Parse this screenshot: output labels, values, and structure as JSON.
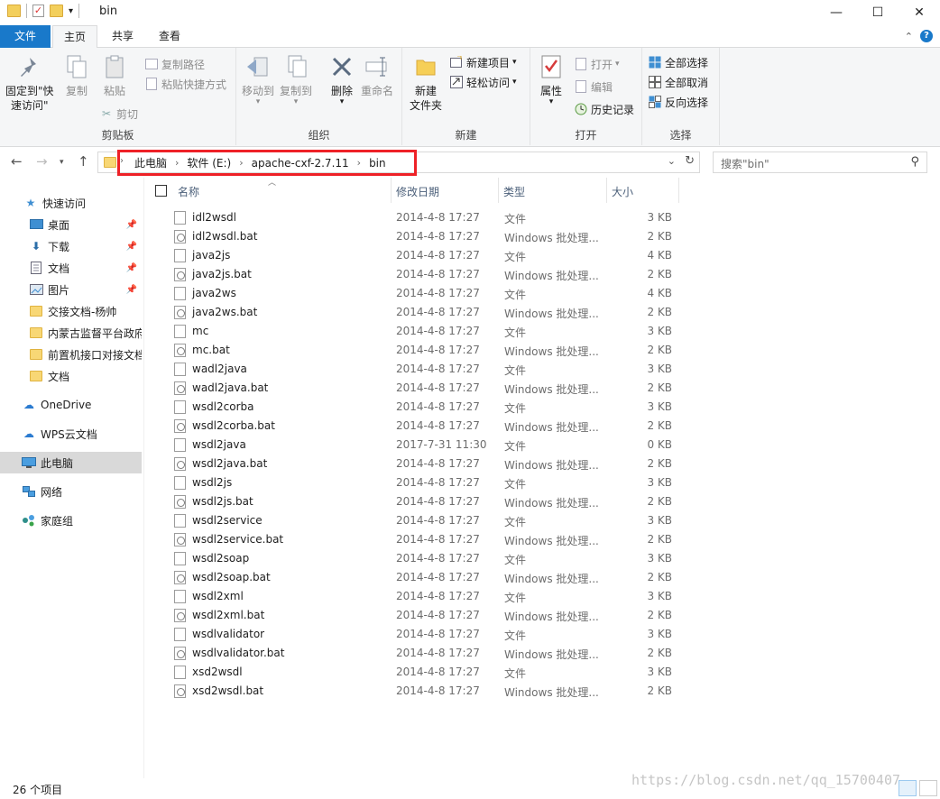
{
  "window": {
    "title": "bin",
    "minimize": "—",
    "maximize": "☐",
    "close": "✕"
  },
  "ribbon_tabs": {
    "file": "文件",
    "home": "主页",
    "share": "共享",
    "view": "查看"
  },
  "ribbon": {
    "clipboard": {
      "pin_label_1": "固定到\"快",
      "pin_label_2": "速访问\"",
      "copy": "复制",
      "paste": "粘贴",
      "copy_path": "复制路径",
      "paste_shortcut": "粘贴快捷方式",
      "cut": "剪切",
      "group": "剪贴板"
    },
    "organize": {
      "move_to": "移动到",
      "copy_to": "复制到",
      "delete": "删除",
      "rename": "重命名",
      "group": "组织"
    },
    "new": {
      "new_folder_1": "新建",
      "new_folder_2": "文件夹",
      "new_item": "新建项目",
      "easy_access": "轻松访问",
      "group": "新建"
    },
    "open": {
      "properties": "属性",
      "open": "打开",
      "edit": "编辑",
      "history": "历史记录",
      "group": "打开"
    },
    "select": {
      "select_all": "全部选择",
      "select_none": "全部取消",
      "invert": "反向选择",
      "group": "选择"
    }
  },
  "address": {
    "crumbs": [
      "此电脑",
      "软件 (E:)",
      "apache-cxf-2.7.11",
      "bin"
    ],
    "search_placeholder": "搜索\"bin\""
  },
  "nav_pane": [
    {
      "label": "快速访问",
      "icon": "star-icon",
      "pinned": false
    },
    {
      "label": "桌面",
      "icon": "desktop-icon",
      "pinned": true
    },
    {
      "label": "下载",
      "icon": "download-icon",
      "pinned": true
    },
    {
      "label": "文档",
      "icon": "documents-icon",
      "pinned": true
    },
    {
      "label": "图片",
      "icon": "pictures-icon",
      "pinned": true
    },
    {
      "label": "交接文档-杨帅",
      "icon": "folder-icon",
      "pinned": false
    },
    {
      "label": "内蒙古监督平台政府",
      "icon": "folder-icon",
      "pinned": false
    },
    {
      "label": "前置机接口对接文档",
      "icon": "folder-icon",
      "pinned": false
    },
    {
      "label": "文档",
      "icon": "folder-icon",
      "pinned": false
    },
    {
      "label": "OneDrive",
      "icon": "cloud-icon",
      "pinned": false
    },
    {
      "label": "WPS云文档",
      "icon": "wps-cloud-icon",
      "pinned": false
    },
    {
      "label": "此电脑",
      "icon": "computer-icon",
      "pinned": false
    },
    {
      "label": "网络",
      "icon": "network-icon",
      "pinned": false
    },
    {
      "label": "家庭组",
      "icon": "homegroup-icon",
      "pinned": false
    }
  ],
  "columns": {
    "name": "名称",
    "date": "修改日期",
    "type": "类型",
    "size": "大小"
  },
  "files": [
    {
      "name": "idl2wsdl",
      "date": "2014-4-8 17:27",
      "type": "文件",
      "size": "3 KB",
      "bat": false
    },
    {
      "name": "idl2wsdl.bat",
      "date": "2014-4-8 17:27",
      "type": "Windows 批处理...",
      "size": "2 KB",
      "bat": true
    },
    {
      "name": "java2js",
      "date": "2014-4-8 17:27",
      "type": "文件",
      "size": "4 KB",
      "bat": false
    },
    {
      "name": "java2js.bat",
      "date": "2014-4-8 17:27",
      "type": "Windows 批处理...",
      "size": "2 KB",
      "bat": true
    },
    {
      "name": "java2ws",
      "date": "2014-4-8 17:27",
      "type": "文件",
      "size": "4 KB",
      "bat": false
    },
    {
      "name": "java2ws.bat",
      "date": "2014-4-8 17:27",
      "type": "Windows 批处理...",
      "size": "2 KB",
      "bat": true
    },
    {
      "name": "mc",
      "date": "2014-4-8 17:27",
      "type": "文件",
      "size": "3 KB",
      "bat": false
    },
    {
      "name": "mc.bat",
      "date": "2014-4-8 17:27",
      "type": "Windows 批处理...",
      "size": "2 KB",
      "bat": true
    },
    {
      "name": "wadl2java",
      "date": "2014-4-8 17:27",
      "type": "文件",
      "size": "3 KB",
      "bat": false
    },
    {
      "name": "wadl2java.bat",
      "date": "2014-4-8 17:27",
      "type": "Windows 批处理...",
      "size": "2 KB",
      "bat": true
    },
    {
      "name": "wsdl2corba",
      "date": "2014-4-8 17:27",
      "type": "文件",
      "size": "3 KB",
      "bat": false
    },
    {
      "name": "wsdl2corba.bat",
      "date": "2014-4-8 17:27",
      "type": "Windows 批处理...",
      "size": "2 KB",
      "bat": true
    },
    {
      "name": "wsdl2java",
      "date": "2017-7-31 11:30",
      "type": "文件",
      "size": "0 KB",
      "bat": false
    },
    {
      "name": "wsdl2java.bat",
      "date": "2014-4-8 17:27",
      "type": "Windows 批处理...",
      "size": "2 KB",
      "bat": true
    },
    {
      "name": "wsdl2js",
      "date": "2014-4-8 17:27",
      "type": "文件",
      "size": "3 KB",
      "bat": false
    },
    {
      "name": "wsdl2js.bat",
      "date": "2014-4-8 17:27",
      "type": "Windows 批处理...",
      "size": "2 KB",
      "bat": true
    },
    {
      "name": "wsdl2service",
      "date": "2014-4-8 17:27",
      "type": "文件",
      "size": "3 KB",
      "bat": false
    },
    {
      "name": "wsdl2service.bat",
      "date": "2014-4-8 17:27",
      "type": "Windows 批处理...",
      "size": "2 KB",
      "bat": true
    },
    {
      "name": "wsdl2soap",
      "date": "2014-4-8 17:27",
      "type": "文件",
      "size": "3 KB",
      "bat": false
    },
    {
      "name": "wsdl2soap.bat",
      "date": "2014-4-8 17:27",
      "type": "Windows 批处理...",
      "size": "2 KB",
      "bat": true
    },
    {
      "name": "wsdl2xml",
      "date": "2014-4-8 17:27",
      "type": "文件",
      "size": "3 KB",
      "bat": false
    },
    {
      "name": "wsdl2xml.bat",
      "date": "2014-4-8 17:27",
      "type": "Windows 批处理...",
      "size": "2 KB",
      "bat": true
    },
    {
      "name": "wsdlvalidator",
      "date": "2014-4-8 17:27",
      "type": "文件",
      "size": "3 KB",
      "bat": false
    },
    {
      "name": "wsdlvalidator.bat",
      "date": "2014-4-8 17:27",
      "type": "Windows 批处理...",
      "size": "2 KB",
      "bat": true
    },
    {
      "name": "xsd2wsdl",
      "date": "2014-4-8 17:27",
      "type": "文件",
      "size": "3 KB",
      "bat": false
    },
    {
      "name": "xsd2wsdl.bat",
      "date": "2014-4-8 17:27",
      "type": "Windows 批处理...",
      "size": "2 KB",
      "bat": true
    }
  ],
  "status": {
    "item_count": "26 个项目"
  },
  "watermark": "https://blog.csdn.net/qq_15700407",
  "colors": {
    "accent": "#1979ca",
    "highlight_box": "#ee2127",
    "selected_nav": "#d9d9d9"
  }
}
